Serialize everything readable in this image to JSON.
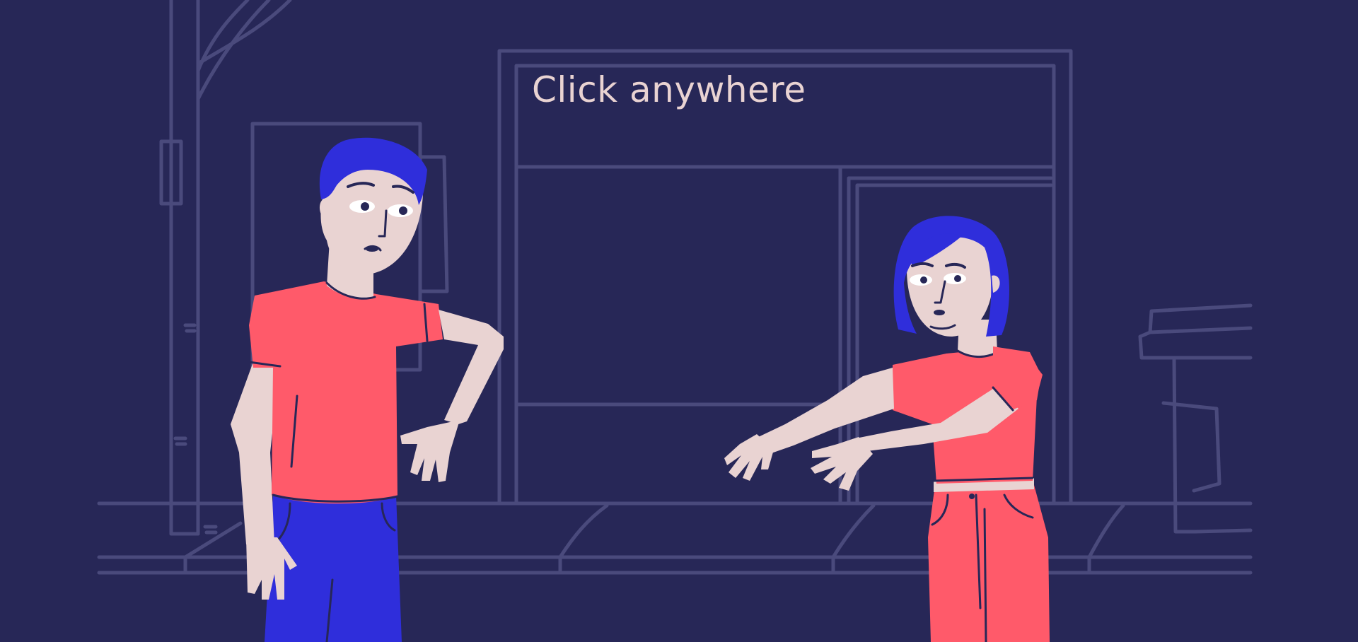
{
  "scene": {
    "prompt": "Click anywhere",
    "characters": [
      {
        "role": "man"
      },
      {
        "role": "woman"
      }
    ]
  },
  "colors": {
    "background": "#272757",
    "line_art": "#4a4a7c",
    "prompt_text": "#e9d3d2",
    "skin": "#e9d3d2",
    "hair": "#2f2edb",
    "shirt": "#ff5a6a",
    "jeans": "#2f2edb",
    "pants_woman": "#ff5a6a",
    "outline": "#272757",
    "belt": "#e9d3d2"
  },
  "icons": {
    "man": "man-character",
    "woman": "woman-character"
  }
}
